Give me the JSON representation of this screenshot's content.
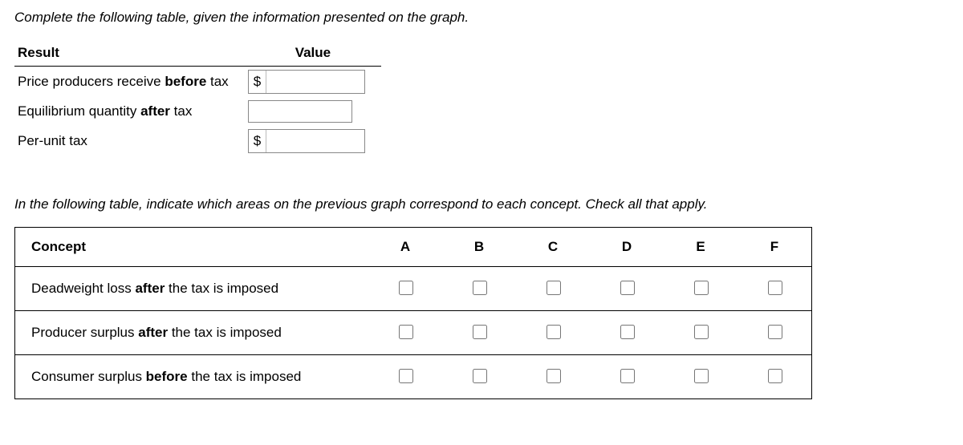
{
  "instruction1": "Complete the following table, given the information presented on the graph.",
  "valueTable": {
    "headers": {
      "result": "Result",
      "value": "Value"
    },
    "rows": [
      {
        "label_pre": "Price producers receive ",
        "label_bold": "before",
        "label_post": " tax",
        "prefix": "$",
        "value": ""
      },
      {
        "label_pre": "Equilibrium quantity ",
        "label_bold": "after",
        "label_post": " tax",
        "prefix": "",
        "value": ""
      },
      {
        "label_pre": "Per-unit tax",
        "label_bold": "",
        "label_post": "",
        "prefix": "$",
        "value": ""
      }
    ]
  },
  "instruction2": "In the following table, indicate which areas on the previous graph correspond to each concept. Check all that apply.",
  "conceptTable": {
    "conceptHeader": "Concept",
    "columns": [
      "A",
      "B",
      "C",
      "D",
      "E",
      "F"
    ],
    "rows": [
      {
        "pre": "Deadweight loss ",
        "bold": "after",
        "post": " the tax is imposed"
      },
      {
        "pre": "Producer surplus  ",
        "bold": "after",
        "post": "  the tax is imposed"
      },
      {
        "pre": "Consumer surplus  ",
        "bold": "before",
        "post": "  the tax is imposed"
      }
    ]
  }
}
